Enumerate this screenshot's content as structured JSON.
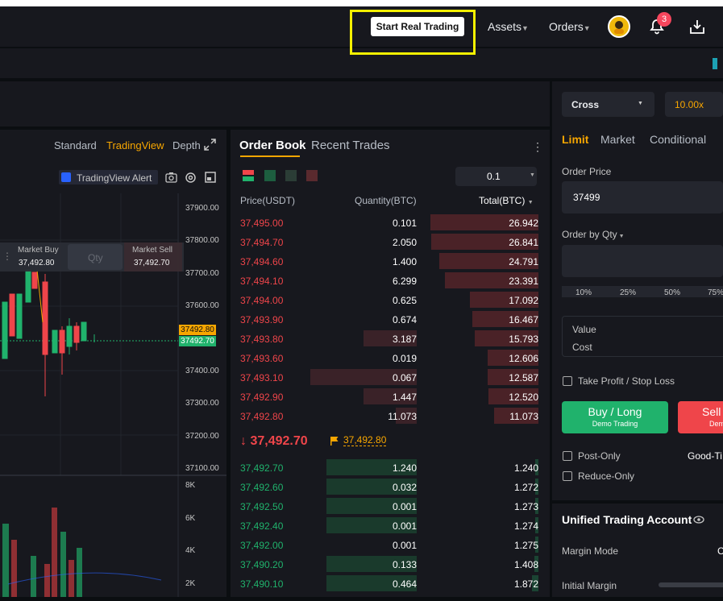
{
  "header": {
    "start_btn": "Start Real Trading",
    "assets": "Assets",
    "orders": "Orders",
    "notif_count": "3"
  },
  "chart": {
    "tabs": [
      "Standard",
      "TradingView",
      "Depth"
    ],
    "active_tab": "TradingView",
    "tv_alert": "TradingView Alert",
    "market_buy": "Market Buy",
    "market_buy_price": "37,492.80",
    "qty_placeholder": "Qty",
    "market_sell": "Market Sell",
    "market_sell_price": "37,492.70",
    "y_ticks": [
      "37900.00",
      "37800.00",
      "37700.00",
      "37600.00",
      "37400.00",
      "37300.00",
      "37200.00",
      "37100.00"
    ],
    "tag_sell": "37492.80",
    "tag_buy": "37492.70",
    "vol_ticks": [
      "8K",
      "6K",
      "4K",
      "2K"
    ]
  },
  "orderbook": {
    "tab_orderbook": "Order Book",
    "tab_trades": "Recent Trades",
    "precision": "0.1",
    "col_price": "Price(USDT)",
    "col_qty": "Quantity(BTC)",
    "col_total": "Total(BTC)",
    "asks": [
      {
        "p": "37,495.00",
        "q": "0.101",
        "t": "26.942",
        "depth": 1.0,
        "qd": 0
      },
      {
        "p": "37,494.70",
        "q": "2.050",
        "t": "26.841",
        "depth": 0.996,
        "qd": 0
      },
      {
        "p": "37,494.60",
        "q": "1.400",
        "t": "24.791",
        "depth": 0.92,
        "qd": 0
      },
      {
        "p": "37,494.10",
        "q": "6.299",
        "t": "23.391",
        "depth": 0.868,
        "qd": 0
      },
      {
        "p": "37,494.00",
        "q": "0.625",
        "t": "17.092",
        "depth": 0.634,
        "qd": 0
      },
      {
        "p": "37,493.90",
        "q": "0.674",
        "t": "16.467",
        "depth": 0.611,
        "qd": 0
      },
      {
        "p": "37,493.80",
        "q": "3.187",
        "t": "15.793",
        "depth": 0.586,
        "qd": 0.5
      },
      {
        "p": "37,493.60",
        "q": "0.019",
        "t": "12.606",
        "depth": 0.468,
        "qd": 0
      },
      {
        "p": "37,493.10",
        "q": "0.067",
        "t": "12.587",
        "depth": 0.467,
        "qd": 1.0
      },
      {
        "p": "37,492.90",
        "q": "1.447",
        "t": "12.520",
        "depth": 0.465,
        "qd": 0.5
      },
      {
        "p": "37,492.80",
        "q": "11.073",
        "t": "11.073",
        "depth": 0.411,
        "qd": 0.2
      }
    ],
    "last_price": "37,492.70",
    "mark_price": "37,492.80",
    "bids": [
      {
        "p": "37,492.70",
        "q": "1.240",
        "t": "1.240",
        "depth": 0.03,
        "qd": 0.85
      },
      {
        "p": "37,492.60",
        "q": "0.032",
        "t": "1.272",
        "depth": 0.03,
        "qd": 0.85
      },
      {
        "p": "37,492.50",
        "q": "0.001",
        "t": "1.273",
        "depth": 0.03,
        "qd": 0.85
      },
      {
        "p": "37,492.40",
        "q": "0.001",
        "t": "1.274",
        "depth": 0.03,
        "qd": 0.85
      },
      {
        "p": "37,492.00",
        "q": "0.001",
        "t": "1.275",
        "depth": 0.03,
        "qd": 0
      },
      {
        "p": "37,490.20",
        "q": "0.133",
        "t": "1.408",
        "depth": 0.04,
        "qd": 0.85
      },
      {
        "p": "37,490.10",
        "q": "0.464",
        "t": "1.872",
        "depth": 0.06,
        "qd": 0.85
      }
    ]
  },
  "trade": {
    "margin": "Cross",
    "leverage": "10.00x",
    "tab_limit": "Limit",
    "tab_market": "Market",
    "tab_conditional": "Conditional",
    "order_price_label": "Order Price",
    "order_price": "37499",
    "order_by_qty": "Order by Qty",
    "pcts": [
      "10%",
      "25%",
      "50%",
      "75%"
    ],
    "value": "Value",
    "cost": "Cost",
    "tpsl": "Take Profit / Stop Loss",
    "buy_label": "Buy / Long",
    "buy_sub": "Demo Trading",
    "sell_label": "Sell",
    "sell_sub": "Dem",
    "post_only": "Post-Only",
    "good_til": "Good-Ti",
    "reduce_only": "Reduce-Only",
    "uta_title": "Unified Trading Account",
    "margin_mode": "Margin Mode",
    "margin_mode_val": "C",
    "initial_margin": "Initial Margin"
  },
  "colors": {
    "green": "#20b26c",
    "red": "#ef454a",
    "accent": "#f7a600"
  }
}
